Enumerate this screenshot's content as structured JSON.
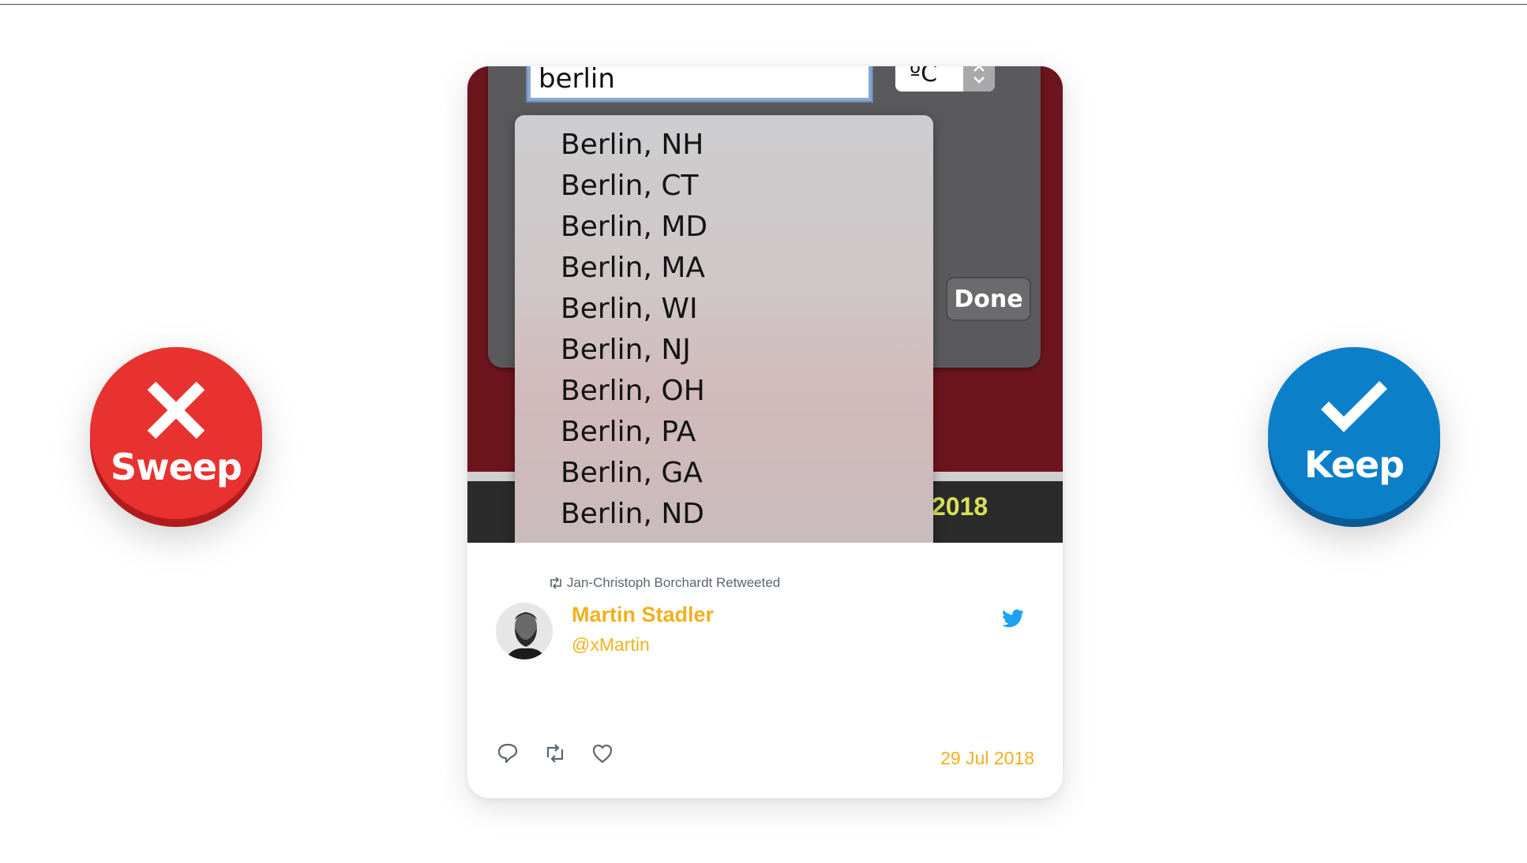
{
  "actions": {
    "sweep_label": "Sweep",
    "keep_label": "Keep",
    "sweep_color": "#e8322f",
    "keep_color": "#0b80c9",
    "sweep_icon": "close-x-icon",
    "keep_icon": "checkmark-icon"
  },
  "screenshot": {
    "city_input_value": "berlin",
    "unit_value": "ºC",
    "done_label": "Done",
    "year_label": "2018",
    "suggestions": [
      "Berlin, NH",
      "Berlin, CT",
      "Berlin, MD",
      "Berlin, MA",
      "Berlin, WI",
      "Berlin, NJ",
      "Berlin, OH",
      "Berlin, PA",
      "Berlin, GA",
      "Berlin, ND"
    ]
  },
  "tweet": {
    "retweet_context": "Jan-Christoph Borchardt Retweeted",
    "author_name": "Martin Stadler",
    "author_handle": "@xMartin",
    "date": "29 Jul 2018",
    "accent_color": "#f2b01e",
    "icons": [
      "retweet-icon",
      "twitter-bird-icon",
      "reply-icon",
      "retweet-icon",
      "like-heart-icon"
    ]
  }
}
